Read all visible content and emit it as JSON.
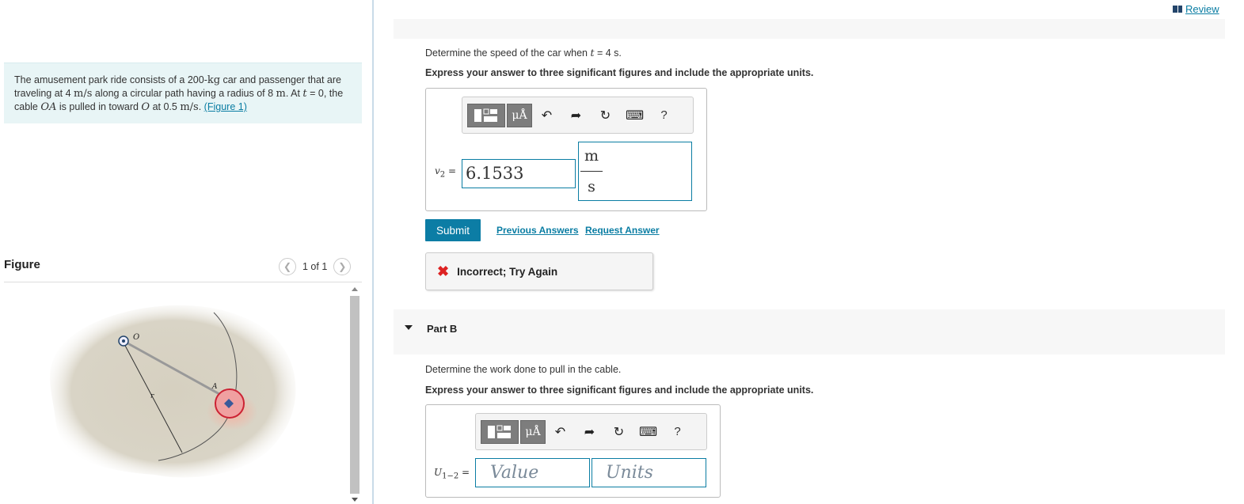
{
  "review": {
    "label": "Review"
  },
  "problem": {
    "t1": "The amusement park ride consists of a 200-",
    "kg": "kg",
    "t2": " car and passenger that are traveling at 4 ",
    "ms": "m/s",
    "t3": " along a circular path having a radius of 8 ",
    "m": "m",
    "t4": ". At ",
    "t": "t",
    "t5": " = 0, the cable ",
    "OA": "OA",
    "t6": " is pulled in toward ",
    "O": "O",
    "t7": " at 0.5 ",
    "ms2": "m/s",
    "t8": ". ",
    "figlink": "(Figure 1)"
  },
  "figure": {
    "title": "Figure",
    "pager": "1 of 1",
    "labels": {
      "O": "O",
      "A": "A",
      "r": "r"
    }
  },
  "partA": {
    "prompt_pre": "Determine the speed of the car when ",
    "prompt_var": "t",
    "prompt_post": " = 4 s.",
    "instruction": "Express your answer to three significant figures and include the appropriate units.",
    "var_name": "v",
    "var_sub": "2",
    "var_eq": " =",
    "value": "6.1533",
    "unit_num": "m",
    "unit_den": "s",
    "submit": "Submit",
    "previous": "Previous Answers",
    "request": "Request Answer",
    "feedback": "Incorrect; Try Again",
    "toolbar": {
      "mu": "μÅ",
      "help": "?"
    }
  },
  "partB": {
    "label": "Part B",
    "prompt": "Determine the work done to pull in the cable.",
    "instruction": "Express your answer to three significant figures and include the appropriate units.",
    "var_name": "U",
    "var_sub": "1−2",
    "var_eq": " =",
    "value_placeholder": "Value",
    "units_placeholder": "Units",
    "toolbar": {
      "mu": "μÅ",
      "help": "?"
    }
  },
  "colors": {
    "accent": "#0c7da5",
    "problem_bg": "#e8f5f6",
    "error": "#dd2222"
  }
}
